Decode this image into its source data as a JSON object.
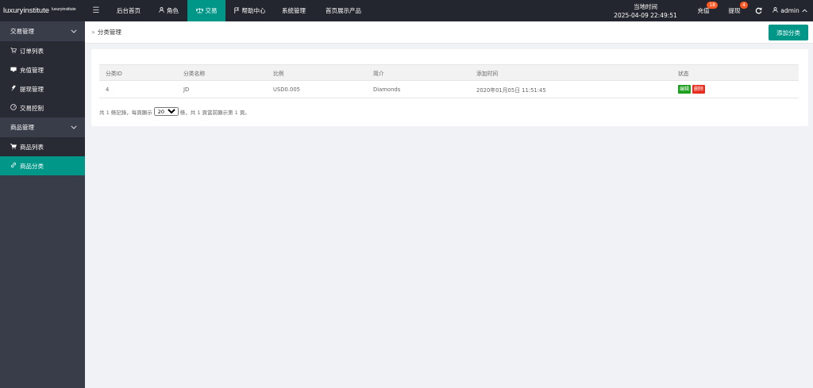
{
  "brand": {
    "name": "luxuryinstitute",
    "sub": "luxuryinstitute"
  },
  "header": {
    "menu_icon": "hamburger-icon",
    "nav": [
      {
        "label": "后台首页",
        "icon": ""
      },
      {
        "label": "角色",
        "icon": "user-icon"
      },
      {
        "label": "交易",
        "icon": "scale-icon",
        "active": true
      },
      {
        "label": "帮助中心",
        "icon": "flag-icon"
      },
      {
        "label": "系统管理",
        "icon": ""
      },
      {
        "label": "首页展示产品",
        "icon": ""
      }
    ],
    "clock_label": "当地时间",
    "clock_time": "2025-04-09 22:49:51",
    "recharge_label": "充值",
    "recharge_badge": "18",
    "withdraw_label": "提现",
    "withdraw_badge": "4",
    "refresh_icon": "refresh-icon",
    "user_label": "admin",
    "accent": "#009688",
    "badge_color": "#ff5722"
  },
  "sidebar": {
    "groups": [
      {
        "label": "交易管理",
        "items": [
          {
            "label": "订单列表",
            "icon": "cart-icon"
          },
          {
            "label": "充值管理",
            "icon": "card-icon"
          },
          {
            "label": "提现管理",
            "icon": "hand-icon"
          },
          {
            "label": "交易控制",
            "icon": "dashboard-icon"
          }
        ]
      },
      {
        "label": "商品管理",
        "items": [
          {
            "label": "商品列表",
            "icon": "cart-icon"
          },
          {
            "label": "商品分类",
            "icon": "link-icon",
            "active": true
          }
        ]
      }
    ]
  },
  "main": {
    "breadcrumb": "分类管理",
    "add_button": "添加分类",
    "table": {
      "headers": [
        "分类ID",
        "分类名称",
        "比例",
        "简介",
        "添加时间",
        "状态"
      ],
      "rows": [
        {
          "id": "4",
          "name": "JD",
          "ratio": "USD0.005",
          "intro": "Diamonds",
          "time": "2020年01月05日 11:51:45",
          "edit": "编辑",
          "delete": "删除"
        }
      ]
    },
    "pager": {
      "prefix": "共 1 條記錄，每頁顯示",
      "page_size": "20",
      "suffix": "條，共 1 頁當前顯示第 1 頁。"
    }
  }
}
